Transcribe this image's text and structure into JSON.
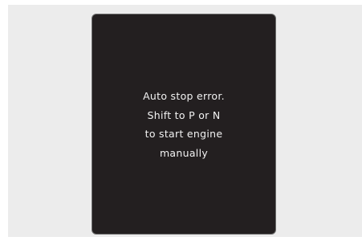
{
  "display": {
    "message_lines": [
      "Auto stop error.",
      "Shift to P or N",
      "to start engine",
      "manually"
    ]
  },
  "colors": {
    "page_background": "#ffffff",
    "panel_background": "#ececec",
    "display_background": "#231f20",
    "display_border": "#6e6e6e",
    "message_text": "#f2f2f2"
  }
}
